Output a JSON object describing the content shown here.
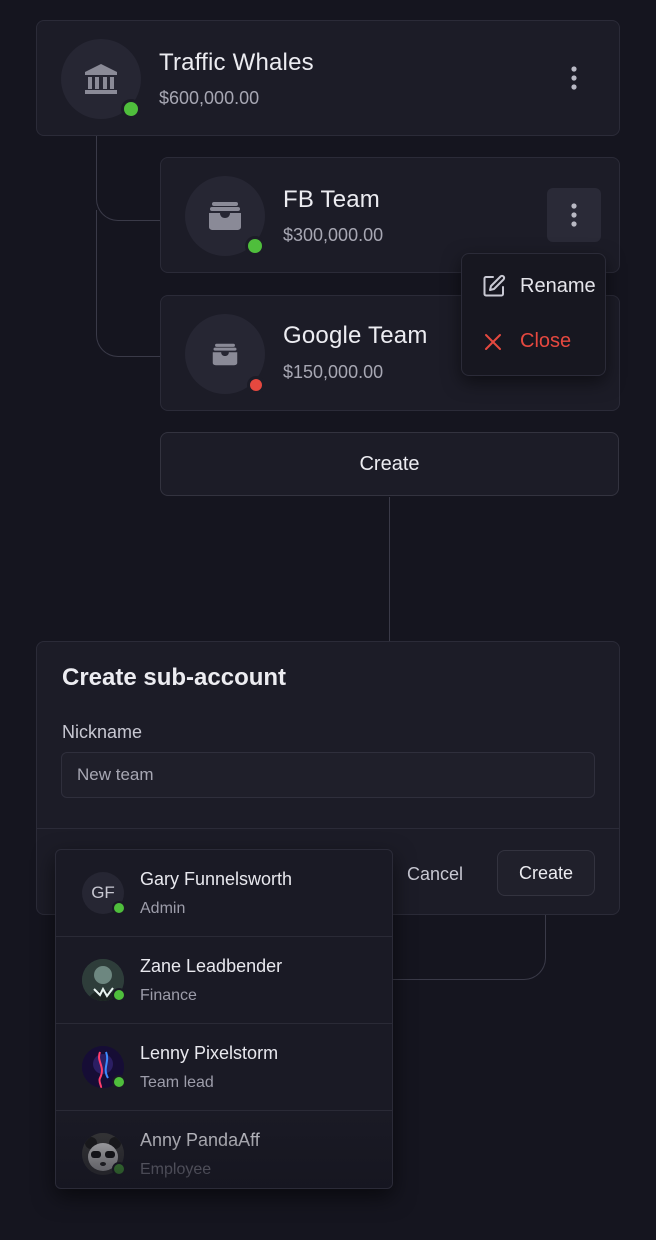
{
  "accounts": [
    {
      "name": "Traffic Whales",
      "amount": "$600,000.00",
      "status": "active",
      "icon": "bank-icon"
    },
    {
      "name": "FB Team",
      "amount": "$300,000.00",
      "status": "active",
      "icon": "wallet-icon"
    },
    {
      "name": "Google Team",
      "amount": "$150,000.00",
      "status": "inactive",
      "icon": "wallet-icon"
    }
  ],
  "context_menu": {
    "rename_label": "Rename",
    "close_label": "Close"
  },
  "create_button_label": "Create",
  "form": {
    "title": "Create sub-account",
    "nickname_label": "Nickname",
    "nickname_value": "New team",
    "cancel_label": "Cancel",
    "create_label": "Create"
  },
  "users": [
    {
      "name": "Gary Funnelsworth",
      "role": "Admin",
      "initials": "GF"
    },
    {
      "name": "Zane Leadbender",
      "role": "Finance"
    },
    {
      "name": "Lenny Pixelstorm",
      "role": "Team lead"
    },
    {
      "name": "Anny PandaAff",
      "role": "Employee"
    }
  ],
  "colors": {
    "background": "#15151f",
    "card": "#1c1c27",
    "active": "#4fbe3c",
    "inactive": "#e5483f",
    "danger": "#e5483f"
  }
}
